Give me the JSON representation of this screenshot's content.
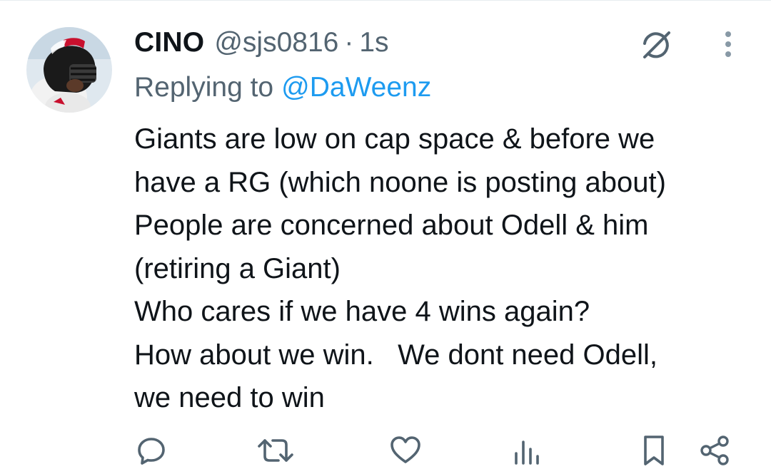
{
  "tweet": {
    "display_name": "CINO",
    "handle": "@sjs0816",
    "separator": "·",
    "time": "1s",
    "reply_prefix": "Replying to",
    "reply_to": "@DaWeenz",
    "text_lines": [
      "Giants are low on cap space & before we",
      "have a RG (which noone is posting about)",
      "People are concerned about Odell & him",
      "(retiring a Giant)",
      "Who cares if we have 4 wins again?",
      "How about we win.   We dont need Odell,",
      "we need to win"
    ]
  },
  "icons": {
    "avatar": "avatar-football-helmet",
    "grok": "grok-icon",
    "more": "more-vertical-icon",
    "reply": "reply-icon",
    "retweet": "retweet-icon",
    "like": "like-icon",
    "views": "views-icon",
    "bookmark": "bookmark-icon",
    "share": "share-icon"
  },
  "colors": {
    "text": "#0f1419",
    "secondary": "#536471",
    "link": "#1d9bf0"
  }
}
